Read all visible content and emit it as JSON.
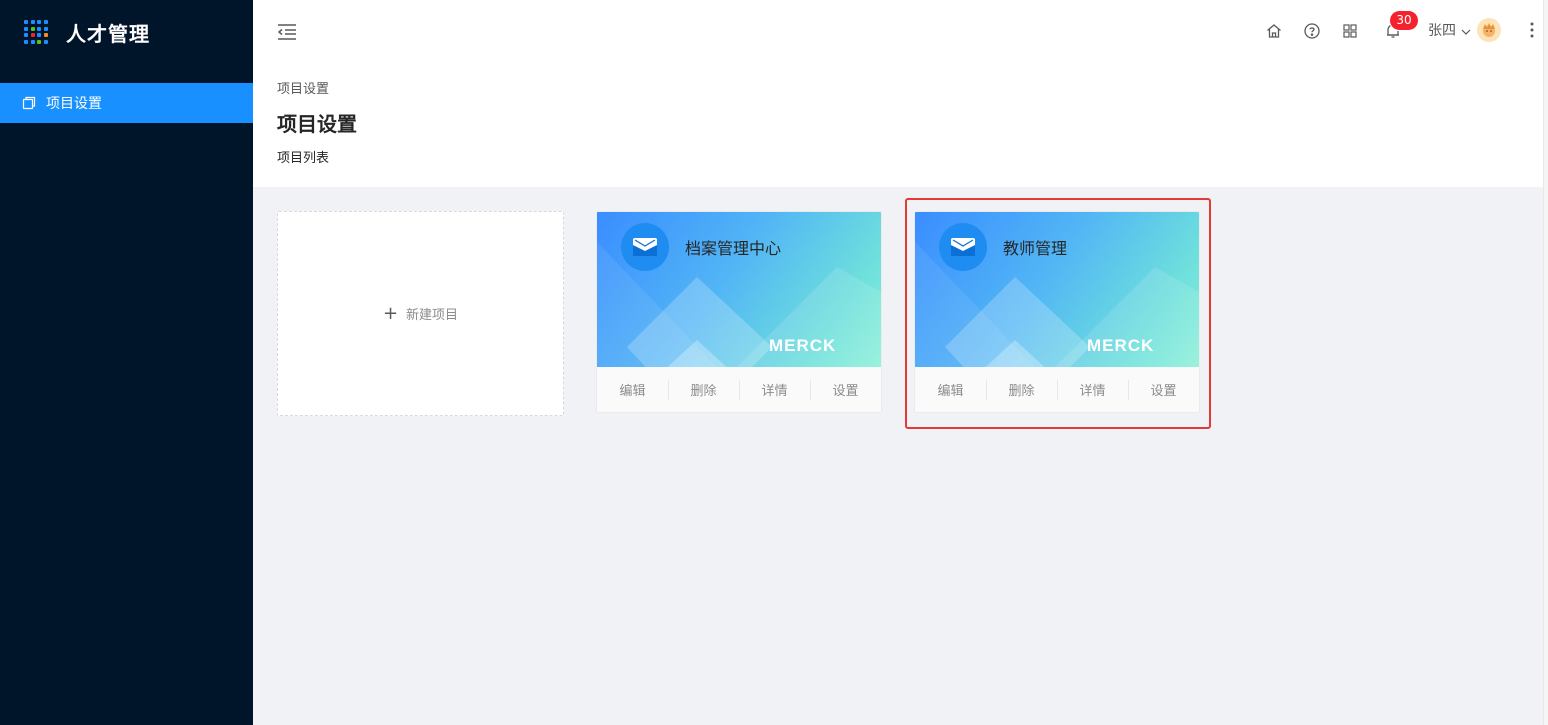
{
  "app": {
    "title": "人才管理",
    "logo_colors": [
      "#1890ff",
      "#1890ff",
      "#1890ff",
      "#1890ff",
      "#1890ff",
      "#52c41a",
      "#1890ff",
      "#1890ff",
      "#1890ff",
      "#f5222d",
      "#1890ff",
      "#fa8c16",
      "#1890ff",
      "#1890ff",
      "#52c41a",
      "#1890ff"
    ]
  },
  "sidebar": {
    "items": [
      {
        "label": "项目设置",
        "icon": "copy-icon",
        "active": true
      }
    ]
  },
  "header": {
    "icons": [
      "menu-fold-icon",
      "home-icon",
      "question-circle-icon",
      "appstore-icon",
      "bell-icon",
      "more-icon"
    ],
    "notification_count": "30",
    "user_name": "张四"
  },
  "page": {
    "breadcrumb": "项目设置",
    "title": "项目设置",
    "subtitle": "项目列表"
  },
  "new_project_label": "新建项目",
  "projects": [
    {
      "name": "档案管理中心",
      "brand": "MERCK",
      "actions": [
        "编辑",
        "删除",
        "详情",
        "设置"
      ],
      "highlighted": false
    },
    {
      "name": "教师管理",
      "brand": "MERCK",
      "actions": [
        "编辑",
        "删除",
        "详情",
        "设置"
      ],
      "highlighted": true
    }
  ],
  "colors": {
    "sidebar_bg": "#001529",
    "accent": "#1890ff",
    "badge": "#f5222d",
    "highlight_border": "#e53935"
  }
}
